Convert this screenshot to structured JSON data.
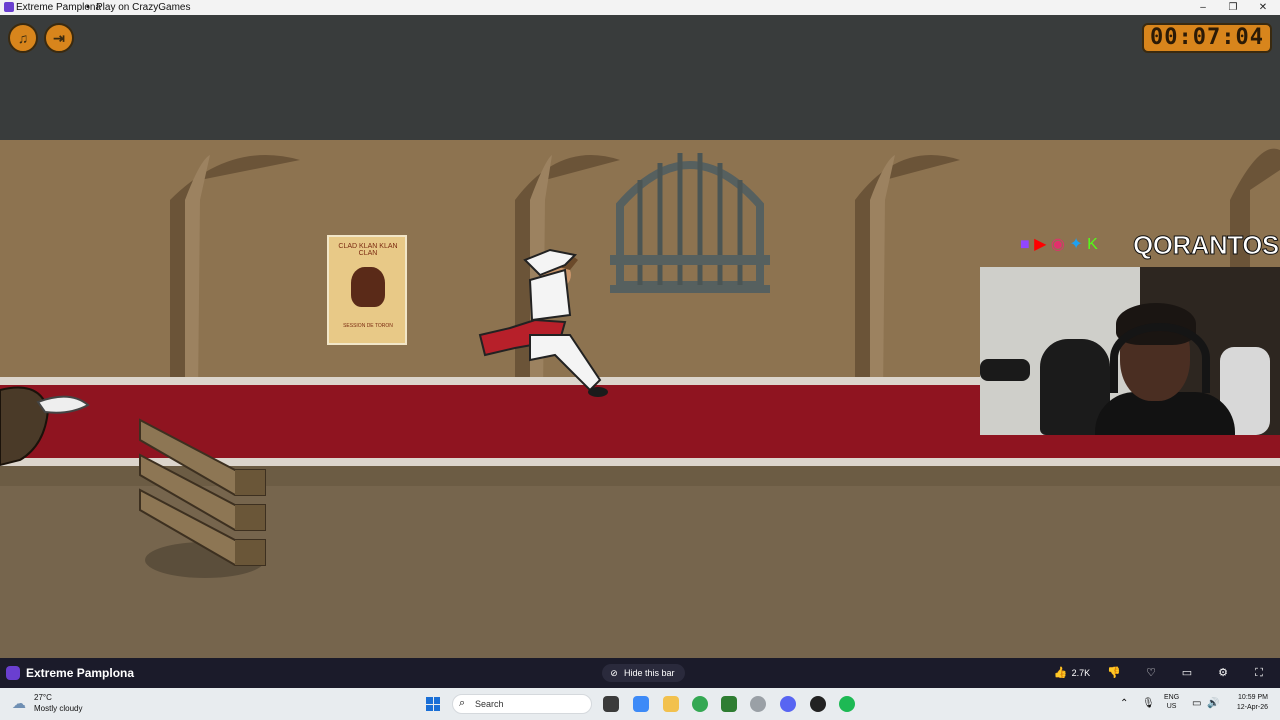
{
  "window": {
    "title": "Extreme Pamplona",
    "separator": "•",
    "subtitle": "Play on CrazyGames",
    "controls": [
      "–",
      "❐",
      "✕"
    ]
  },
  "game": {
    "timer": "00:07:04",
    "hud_buttons": [
      "sound-icon",
      "exit-icon"
    ],
    "poster_header": "CLAD KLAN KLAN CLAN",
    "poster_footer": "SESSION DE TORON",
    "brand_name": "QORANTOS",
    "brand_socials": [
      "twitch-icon",
      "youtube-icon",
      "instagram-icon",
      "twitter-icon",
      "kick-icon"
    ]
  },
  "crazygames_bar": {
    "game_name": "Extreme Pamplona",
    "hide_label": "Hide this bar",
    "likes": "2.7K",
    "buttons": [
      "thumbs-up-icon",
      "thumbs-down-icon",
      "heart-icon",
      "feedback-icon",
      "share-icon",
      "fullscreen-icon"
    ]
  },
  "taskbar": {
    "temperature": "27°C",
    "condition": "Mostly cloudy",
    "search_placeholder": "Search",
    "lang_top": "ENG",
    "lang_bottom": "US",
    "time": "10:59 PM",
    "date": "12-Apr-26"
  },
  "colors": {
    "accent_orange": "#d8851c",
    "red_band": "#8f1420",
    "taskbar_bg": "#e8ecef",
    "crazy_purple": "#6a3fd0"
  }
}
